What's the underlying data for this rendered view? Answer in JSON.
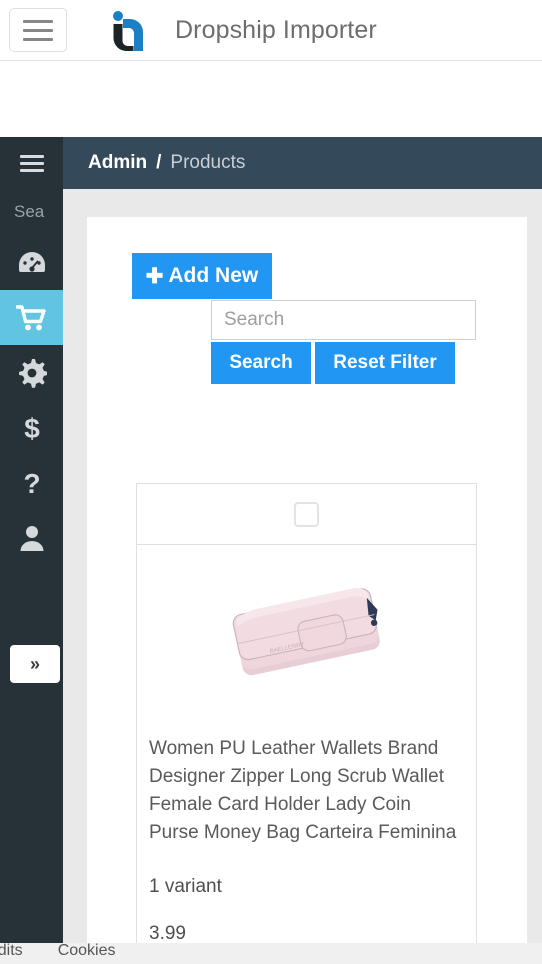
{
  "topnav": {
    "toggle_icon": "hamburger-icon",
    "logo_icon": "ia-brand-logo",
    "title": "Dropship Importer"
  },
  "sidebar": {
    "toggle_icon": "hamburger-icon",
    "search_text": "Sea",
    "search_placeholder": "Search",
    "expand_label": "»",
    "items": [
      {
        "icon": "dashboard-icon",
        "label": "Dashboard",
        "active": false
      },
      {
        "icon": "shopping-cart-icon",
        "label": "Products",
        "active": true
      },
      {
        "icon": "gear-icon",
        "label": "Settings",
        "active": false
      },
      {
        "icon": "dollar-icon",
        "label": "Billing",
        "active": false
      },
      {
        "icon": "question-mark-icon",
        "label": "Help",
        "active": false
      },
      {
        "icon": "user-icon",
        "label": "Account",
        "active": false
      }
    ]
  },
  "breadcrumb": {
    "root": "Admin",
    "separator": "/",
    "current": "Products"
  },
  "toolbar": {
    "add_new_label": "Add New",
    "add_new_icon": "plus-icon",
    "search_value": "",
    "search_placeholder": "Search",
    "search_label": "Search",
    "reset_label": "Reset Filter"
  },
  "products": {
    "select_all_checked": false,
    "rows": [
      {
        "image_icon": "pink-wallet-image",
        "title": "Women PU Leather Wallets Brand Designer Zipper Long Scrub Wallet Female Card Holder Lady Coin Purse Money Bag Carteira Feminina",
        "variants": "1 variant",
        "price": "3.99"
      }
    ]
  },
  "footer": {
    "link1": "Credits",
    "link2": "Cookies"
  },
  "colors": {
    "primary_blue": "#2196f3",
    "sidebar_dark": "#273238",
    "sidebar_active": "#61c4e2",
    "breadcrumb_bg": "#34495a",
    "page_bg": "#e9e9e9"
  }
}
